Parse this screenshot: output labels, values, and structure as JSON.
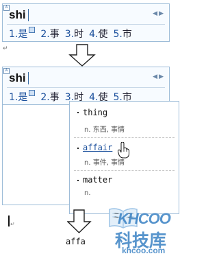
{
  "ime1": {
    "pinyin": "shi",
    "candidates": [
      {
        "num": "1.",
        "char": "是"
      },
      {
        "num": "2.",
        "char": "事"
      },
      {
        "num": "3.",
        "char": "时"
      },
      {
        "num": "4.",
        "char": "使"
      },
      {
        "num": "5.",
        "char": "市"
      }
    ]
  },
  "ime2": {
    "pinyin": "shi",
    "candidates": [
      {
        "num": "1.",
        "char": "是"
      },
      {
        "num": "2.",
        "char": "事"
      },
      {
        "num": "3.",
        "char": "时"
      },
      {
        "num": "4.",
        "char": "使"
      },
      {
        "num": "5.",
        "char": "市"
      }
    ]
  },
  "dictionary": [
    {
      "word": "thing",
      "definition": "n. 东西, 事情"
    },
    {
      "word": "affair",
      "definition": "n. 事件, 事情"
    },
    {
      "word": "matter",
      "definition": "n."
    }
  ],
  "result_text": "affa",
  "watermark": {
    "brand": "KHCOO",
    "chinese": "科技库",
    "url": "khcoo.com"
  },
  "colors": {
    "accent": "#1a4f9c",
    "border": "#9dbcd8",
    "ime_bg": "#f7fbff",
    "watermark": "#3a82c4"
  }
}
